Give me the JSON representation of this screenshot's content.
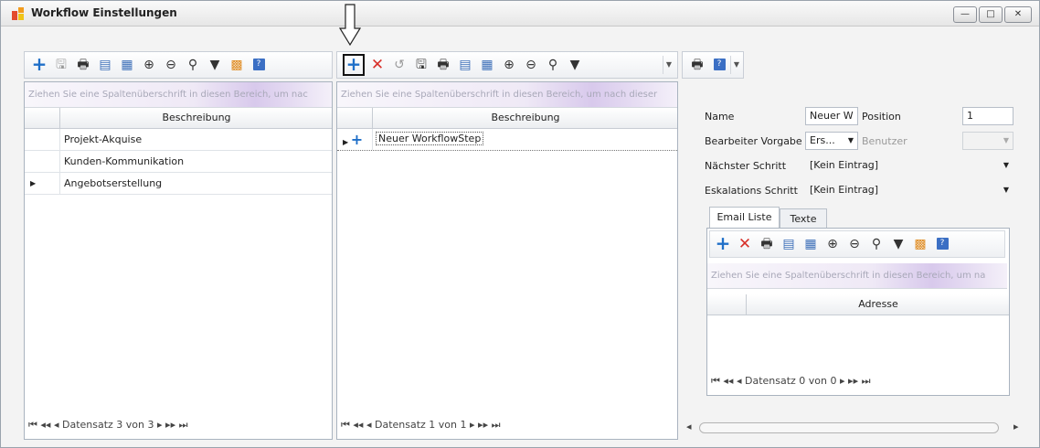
{
  "window": {
    "title": "Workflow Einstellungen",
    "controls": {
      "minimize": "—",
      "maximize": "□",
      "close": "✕"
    }
  },
  "left_panel": {
    "group_hint": "Ziehen Sie eine Spaltenüberschrift in diesen Bereich, um nac",
    "column_header": "Beschreibung",
    "rows": [
      {
        "label": "Projekt-Akquise"
      },
      {
        "label": "Kunden-Kommunikation"
      },
      {
        "label": "Angebotserstellung"
      }
    ],
    "navigator": {
      "status": "Datensatz 3 von 3"
    }
  },
  "middle_panel": {
    "group_hint": "Ziehen Sie eine Spaltenüberschrift in diesen Bereich, um nach dieser",
    "column_header": "Beschreibung",
    "rows": [
      {
        "label": "Neuer WorkflowStep"
      }
    ],
    "navigator": {
      "status": "Datensatz 1 von 1"
    }
  },
  "form": {
    "name_label": "Name",
    "name_value": "Neuer W",
    "position_label": "Position",
    "position_value": "1",
    "bearbeiter_label": "Bearbeiter Vorgabe",
    "bearbeiter_value": "Ers...",
    "benutzer_label": "Benutzer",
    "naechster_label": "Nächster Schritt",
    "naechster_value": "[Kein Eintrag]",
    "eskalation_label": "Eskalations Schritt",
    "eskalation_value": "[Kein Eintrag]"
  },
  "tabs": [
    {
      "label": "Email Liste"
    },
    {
      "label": "Texte"
    }
  ],
  "email_panel": {
    "group_hint": "Ziehen Sie eine Spaltenüberschrift in diesen Bereich, um na",
    "column_header": "Adresse",
    "navigator": {
      "status": "Datensatz 0 von 0"
    }
  },
  "glyphs": {
    "first": "⏮",
    "prev_page": "◂◂",
    "prev": "◂",
    "next": "▸",
    "next_page": "▸▸",
    "last": "⏭"
  }
}
